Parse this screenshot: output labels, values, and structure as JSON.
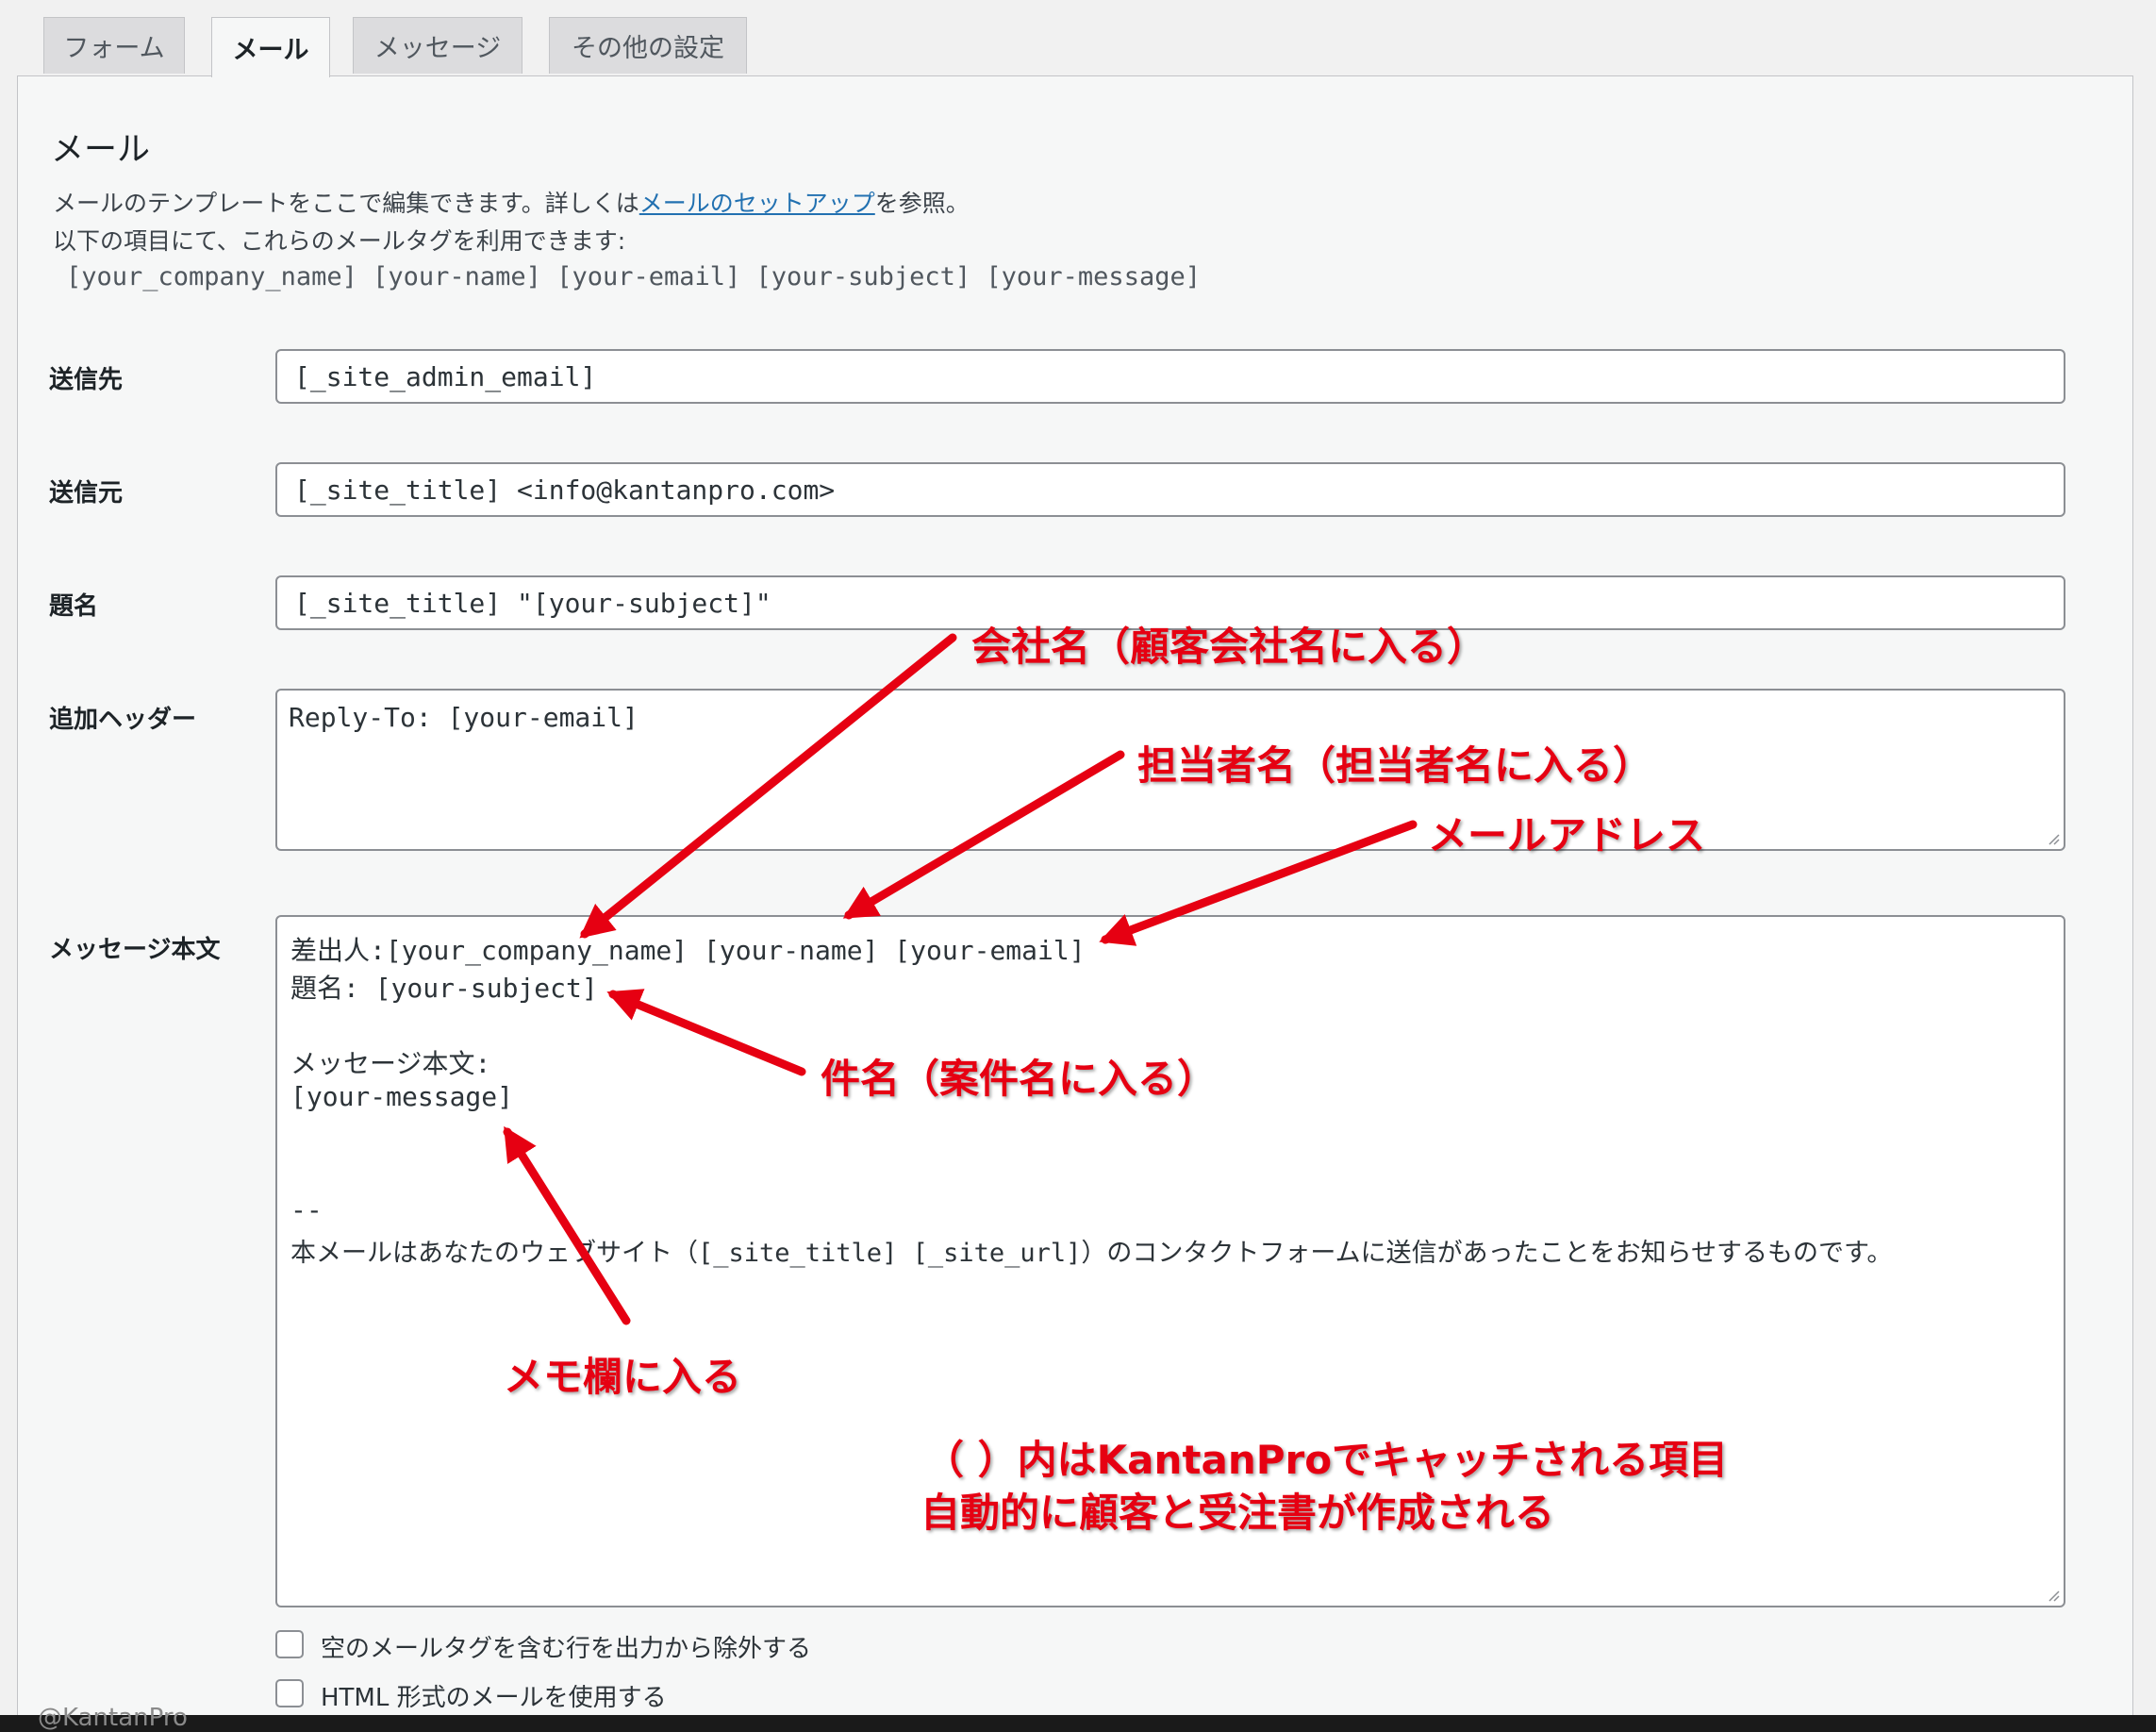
{
  "tabs": [
    {
      "label": "フォーム"
    },
    {
      "label": "メール"
    },
    {
      "label": "メッセージ"
    },
    {
      "label": "その他の設定"
    }
  ],
  "panel": {
    "heading": "メール",
    "desc_prefix": "メールのテンプレートをここで編集できます。詳しくは",
    "desc_link": "メールのセットアップ",
    "desc_suffix": "を参照。",
    "desc_line2": "以下の項目にて、これらのメールタグを利用できます:",
    "mail_tags": [
      "[your_company_name]",
      "[your-name]",
      "[your-email]",
      "[your-subject]",
      "[your-message]"
    ]
  },
  "fields": {
    "to": {
      "label": "送信先",
      "value": "[_site_admin_email]"
    },
    "from": {
      "label": "送信元",
      "value": "[_site_title] <info@kantanpro.com>"
    },
    "subject": {
      "label": "題名",
      "value": "[_site_title] \"[your-subject]\""
    },
    "headers": {
      "label": "追加ヘッダー",
      "value": "Reply-To: [your-email]"
    },
    "body": {
      "label": "メッセージ本文",
      "lines": [
        "差出人:[your_company_name] [your-name] [your-email]",
        "題名: [your-subject]",
        "メッセージ本文:",
        "[your-message]",
        "--",
        "本メールはあなたのウェブサイト（[_site_title] [_site_url]）のコンタクトフォームに送信があったことをお知らせするものです。"
      ]
    }
  },
  "options": [
    {
      "label": "空のメールタグを含む行を出力から除外する",
      "checked": false
    },
    {
      "label": "HTML 形式のメールを使用する",
      "checked": false
    }
  ],
  "annotations": {
    "company": "会社名（顧客会社名に入る）",
    "person": "担当者名（担当者名に入る）",
    "email": "メールアドレス",
    "subject": "件名（案件名に入る）",
    "memo": "メモ欄に入る",
    "note_line1": "（ ）内はKantanProでキャッチされる項目",
    "note_line2": "自動的に顧客と受注書が作成される"
  },
  "watermark": "@KantanPro",
  "colors": {
    "annotation": "#e60012",
    "link": "#2271b1",
    "border": "#8c8f94"
  }
}
